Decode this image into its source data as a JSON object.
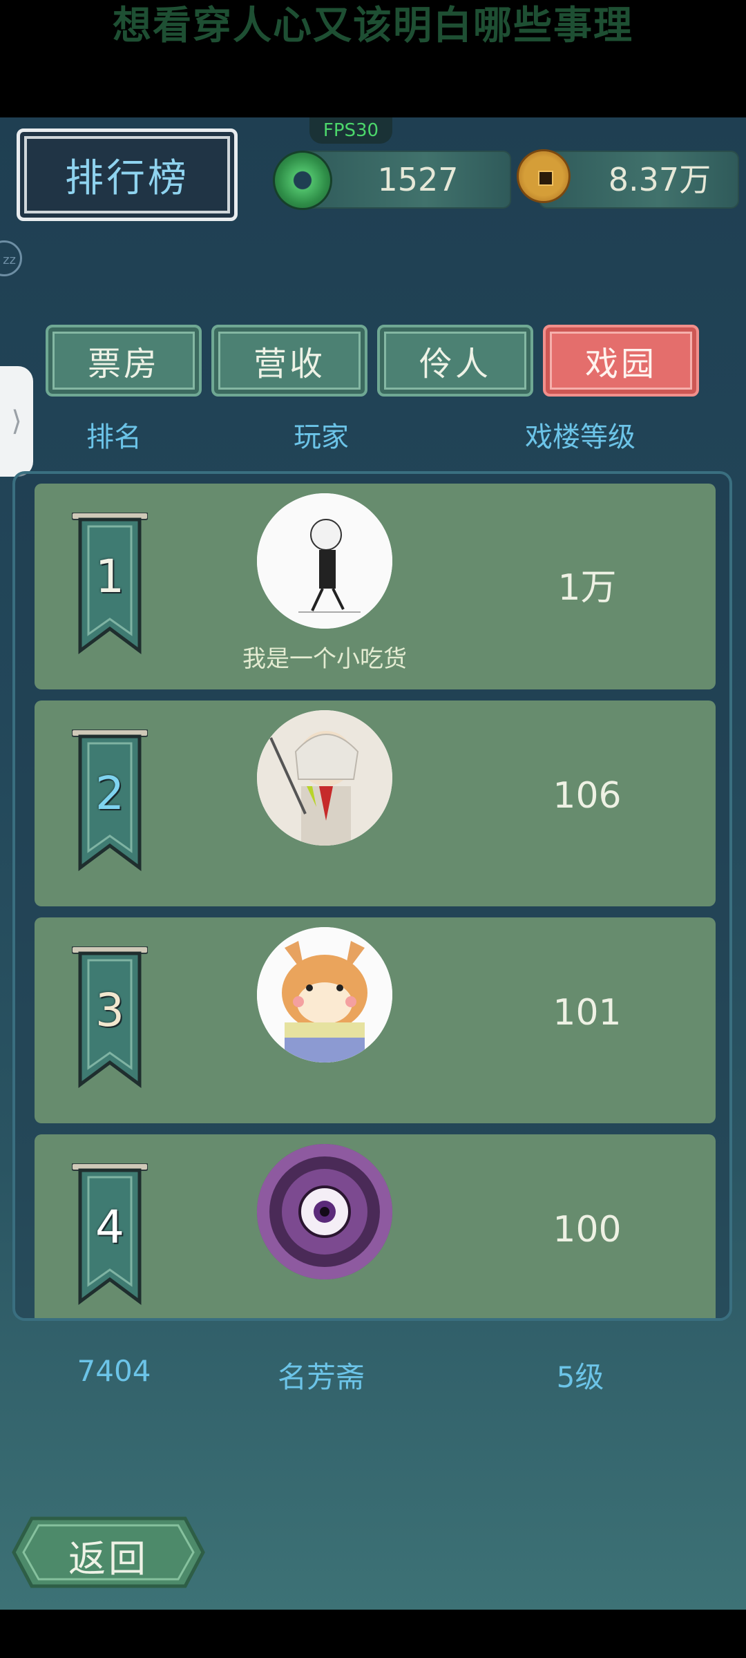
{
  "banner": {
    "title": "想看穿人心又该明白哪些事理"
  },
  "hud": {
    "fps": "FPS30",
    "title": "排行榜",
    "jade_value": "1527",
    "coin_value": "8.37万"
  },
  "tabs": [
    {
      "label": "票房",
      "active": false
    },
    {
      "label": "营收",
      "active": false
    },
    {
      "label": "伶人",
      "active": false
    },
    {
      "label": "戏园",
      "active": true
    }
  ],
  "columns": {
    "rank": "排名",
    "player": "玩家",
    "level": "戏楼等级"
  },
  "rows": [
    {
      "rank": "1",
      "name": "我是一个小吃货",
      "level": "1万"
    },
    {
      "rank": "2",
      "name": "",
      "level": "106"
    },
    {
      "rank": "3",
      "name": "",
      "level": "101"
    },
    {
      "rank": "4",
      "name": "",
      "level": "100"
    }
  ],
  "my_entry": {
    "rank": "7404",
    "name": "名芳斋",
    "level": "5级"
  },
  "back_label": "返回",
  "colors": {
    "active_tab": "#e46e6c",
    "tab": "#4c8173",
    "row": "#678c6e",
    "header_text": "#6cc4e8"
  }
}
